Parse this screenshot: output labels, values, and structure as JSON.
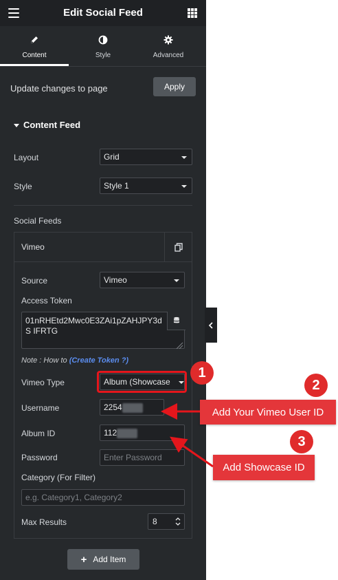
{
  "header": {
    "title": "Edit Social Feed",
    "menu_icon": "hamburger-icon",
    "apps_icon": "grid-icon"
  },
  "tabs": [
    {
      "label": "Content",
      "icon": "pencil-icon",
      "active": true
    },
    {
      "label": "Style",
      "icon": "half-circle-icon",
      "active": false
    },
    {
      "label": "Advanced",
      "icon": "gear-icon",
      "active": false
    }
  ],
  "update": {
    "label": "Update changes to page",
    "button": "Apply"
  },
  "section": {
    "title": "Content Feed"
  },
  "layout": {
    "label": "Layout",
    "value": "Grid"
  },
  "style": {
    "label": "Style",
    "value": "Style 1"
  },
  "social_feeds": {
    "label": "Social Feeds",
    "item": {
      "name": "Vimeo",
      "source": {
        "label": "Source",
        "value": "Vimeo"
      },
      "access_token": {
        "label": "Access Token",
        "value": "01nRHEtd2Mwc0E3ZAi1pZAHJPY3dS IFRTG"
      },
      "note": {
        "prefix": "Note : How to ",
        "link": "(Create Token ?)"
      },
      "vimeo_type": {
        "label": "Vimeo Type",
        "value": "Album (Showcase"
      },
      "username": {
        "label": "Username",
        "value": "2254"
      },
      "album_id": {
        "label": "Album ID",
        "value": "112"
      },
      "password": {
        "label": "Password",
        "placeholder": "Enter Password"
      },
      "category": {
        "label": "Category (For Filter)",
        "placeholder": "e.g. Category1, Category2"
      },
      "max_results": {
        "label": "Max Results",
        "value": "8"
      }
    },
    "add_button": "Add Item"
  },
  "annotations": {
    "badges": [
      "1",
      "2",
      "3"
    ],
    "callout_user": "Add Your Vimeo User ID",
    "callout_showcase": "Add Showcase ID",
    "accent_color": "#e4363a"
  }
}
